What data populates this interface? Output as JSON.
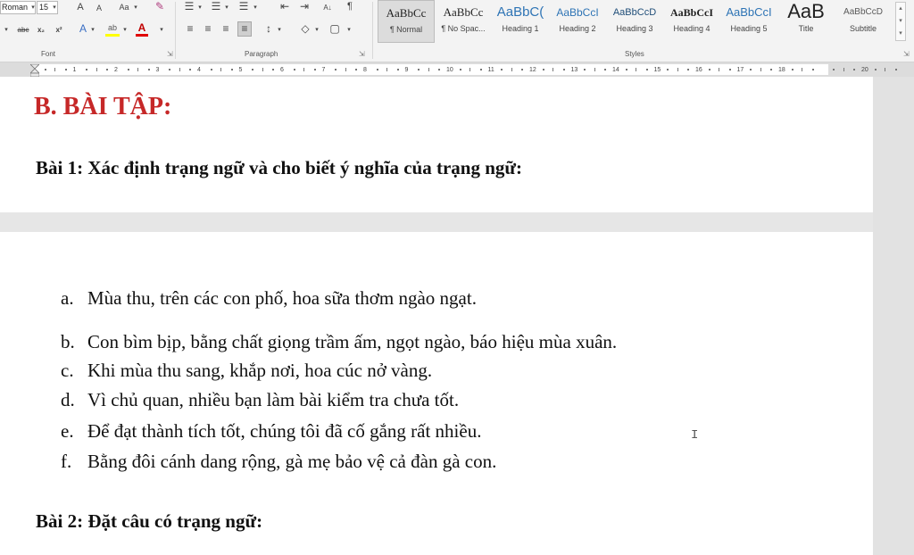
{
  "ribbon": {
    "font": {
      "name": "Roman",
      "size": "15",
      "grow_label": "A",
      "shrink_label": "A",
      "case_label": "Aa",
      "strike_label": "abc",
      "subscript_label": "x₂",
      "superscript_label": "x²",
      "text_effects_label": "A",
      "highlight_label": "ab",
      "font_color_label": "A",
      "group_label": "Font"
    },
    "paragraph": {
      "sort_label": "A↓",
      "pilcrow_label": "¶",
      "group_label": "Paragraph"
    },
    "styles": {
      "items": [
        {
          "preview": "AaBbCc",
          "name": "¶ Normal"
        },
        {
          "preview": "AaBbCc",
          "name": "¶ No Spac..."
        },
        {
          "preview": "AaBbC(",
          "name": "Heading 1"
        },
        {
          "preview": "AaBbCcI",
          "name": "Heading 2"
        },
        {
          "preview": "AaBbCcD",
          "name": "Heading 3"
        },
        {
          "preview": "AaBbCcI",
          "name": "Heading 4"
        },
        {
          "preview": "AaBbCcI",
          "name": "Heading 5"
        },
        {
          "preview": "AaB",
          "name": "Title"
        },
        {
          "preview": "AaBbCcD",
          "name": "Subtitle"
        }
      ],
      "group_label": "Styles"
    }
  },
  "ruler": {
    "numbers": [
      "1",
      "2",
      "3",
      "4",
      "5",
      "6",
      "7",
      "8",
      "9",
      "10",
      "11",
      "12",
      "13",
      "14",
      "15",
      "16",
      "17",
      "18",
      "20"
    ]
  },
  "document": {
    "section_heading": "B. BÀI TẬP:",
    "exercise1_title": "Bài 1: Xác định trạng ngữ và cho biết ý nghĩa của trạng ngữ:",
    "exercise1_items": [
      {
        "marker": "a.",
        "text": "Mùa thu, trên các con phố, hoa sữa thơm ngào ngạt."
      },
      {
        "marker": "b.",
        "text": "Con bìm bịp, bằng chất giọng trầm ấm, ngọt ngào, báo hiệu mùa xuân."
      },
      {
        "marker": "c.",
        "text": "Khi mùa thu sang, khắp nơi, hoa cúc nở vàng."
      },
      {
        "marker": "d.",
        "text": "Vì chủ quan, nhiều bạn làm bài kiểm tra chưa tốt."
      },
      {
        "marker": "e.",
        "text": "Để đạt thành tích tốt, chúng tôi đã cố gắng rất nhiều."
      },
      {
        "marker": "f.",
        "text": "Bằng đôi cánh dang rộng, gà mẹ bảo vệ cả đàn gà con."
      }
    ],
    "exercise2_title": "Bài 2: Đặt câu có trạng ngữ:"
  },
  "cursor_glyph": "I",
  "colors": {
    "heading_red": "#c62828",
    "ribbon_bg": "#f3f3f3",
    "workspace_bg": "#e6e6e6",
    "heading_style_blue": "#2e74b5",
    "font_color_red": "#e00000",
    "highlight_yellow": "#ffff00"
  }
}
